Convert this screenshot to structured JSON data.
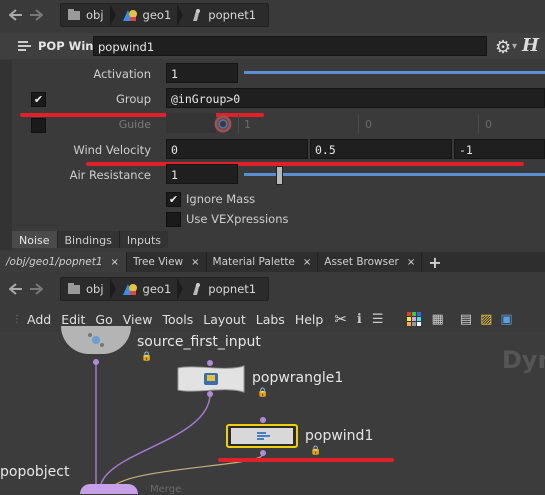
{
  "param_pane": {
    "path": [
      "obj",
      "geo1",
      "popnet1"
    ],
    "node_type": "POP Wind",
    "node_name": "popwind1",
    "params": {
      "activation": {
        "label": "Activation",
        "value": "1"
      },
      "group": {
        "label": "Group",
        "value": "@inGroup>0"
      },
      "guide": {
        "label": "Guide",
        "values": [
          "1",
          "0",
          "0"
        ]
      },
      "wind_velocity": {
        "label": "Wind Velocity",
        "values": [
          "0",
          "0.5",
          "-1"
        ]
      },
      "air_resistance": {
        "label": "Air Resistance",
        "value": "1"
      },
      "ignore_mass": {
        "label": "Ignore Mass",
        "checked": true
      },
      "use_vex": {
        "label": "Use VEXpressions",
        "checked": false
      }
    },
    "tabs": [
      "Noise",
      "Bindings",
      "Inputs"
    ]
  },
  "pane_tabs": [
    {
      "label": "/obj/geo1/popnet1"
    },
    {
      "label": "Tree View"
    },
    {
      "label": "Material Palette"
    },
    {
      "label": "Asset Browser"
    }
  ],
  "add_tab_glyph": "+",
  "close_glyph": "×",
  "network_pane": {
    "path": [
      "obj",
      "geo1",
      "popnet1"
    ],
    "menu": [
      "Add",
      "Edit",
      "Go",
      "View",
      "Tools",
      "Layout",
      "Labs",
      "Help"
    ],
    "watermark": "Dyn",
    "nodes": {
      "source": "source_first_input",
      "wrangle": "popwrangle1",
      "wind": "popwind1",
      "popobject": "popobject",
      "merge": "Merge"
    }
  },
  "colors": {
    "accent_red": "#e2202a",
    "node_selected": "#f0d000",
    "wire_purple": "#a07ac8"
  }
}
